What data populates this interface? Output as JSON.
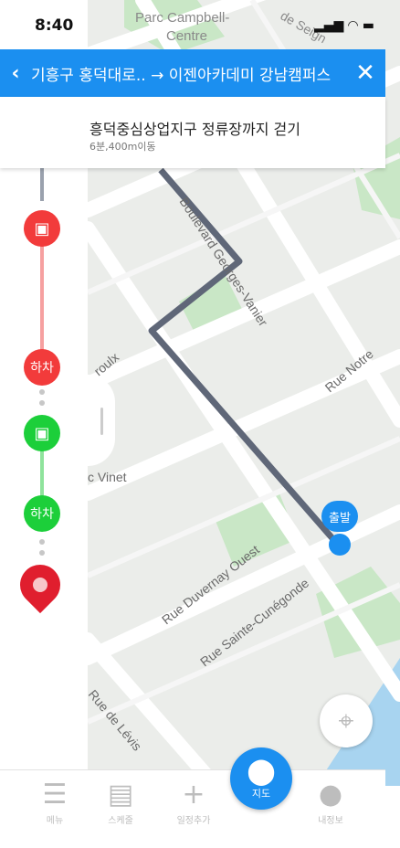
{
  "status_bar": {
    "time": "8:40",
    "icons": "▂▄▆ ◠ ▬"
  },
  "header": {
    "back_icon": "chevron-left",
    "route": "기흥구 홍덕대로.. →  이젠아카데미 강남캠퍼스",
    "close_icon": "close"
  },
  "step": {
    "title": "흥덕중심상업지구 정류장까지 걷기",
    "detail": "6분,400m이동"
  },
  "timeline": {
    "alight_1": "하차",
    "alight_2": "하차"
  },
  "map_labels": {
    "parc": "Parc Campbell-",
    "centre": "Centre",
    "boulevard": "Boulevard Georges-Vanier",
    "notre": "Rue Notre",
    "roulx": "roulx",
    "vinet": "c Vinet",
    "duvernay": "Rue Duvernay Ouest",
    "cunegonde": "Rue Sainte-Cunégonde",
    "levis": "Rue de Lévis",
    "seigneurs": "de Seign",
    "start_badge": "출발"
  },
  "tabs": [
    {
      "label": "메뉴"
    },
    {
      "label": "스케줄"
    },
    {
      "label": "일정추가"
    },
    {
      "label": "지도"
    },
    {
      "label": "내정보"
    }
  ],
  "colors": {
    "blue": "#1b8ff0",
    "walk": "#5f6778",
    "bus_red": "#f23b3b",
    "bus_green": "#1ccf3a"
  }
}
